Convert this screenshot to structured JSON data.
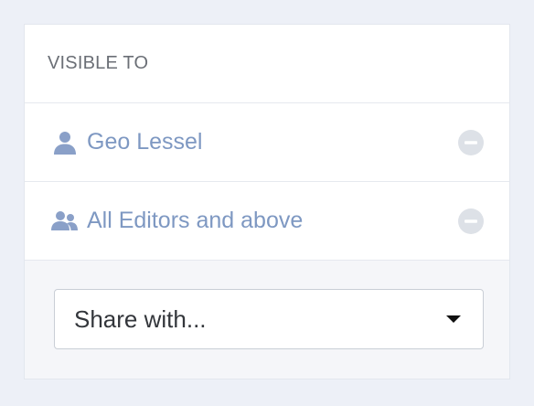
{
  "panel": {
    "title": "VISIBLE TO"
  },
  "share_list": [
    {
      "icon": "user-icon",
      "label": "Geo Lessel",
      "remove_icon": "minus-circle-icon"
    },
    {
      "icon": "users-icon",
      "label": "All Editors and above",
      "remove_icon": "minus-circle-icon"
    }
  ],
  "share_select": {
    "value": "Share with...",
    "icon": "caret-down-icon"
  },
  "colors": {
    "page_background": "#edf0f7",
    "link_blue": "#7e98c2",
    "icon_blue": "#8aa0c8",
    "remove_gray": "#dde1e7",
    "footer_background": "#f5f6f9"
  }
}
